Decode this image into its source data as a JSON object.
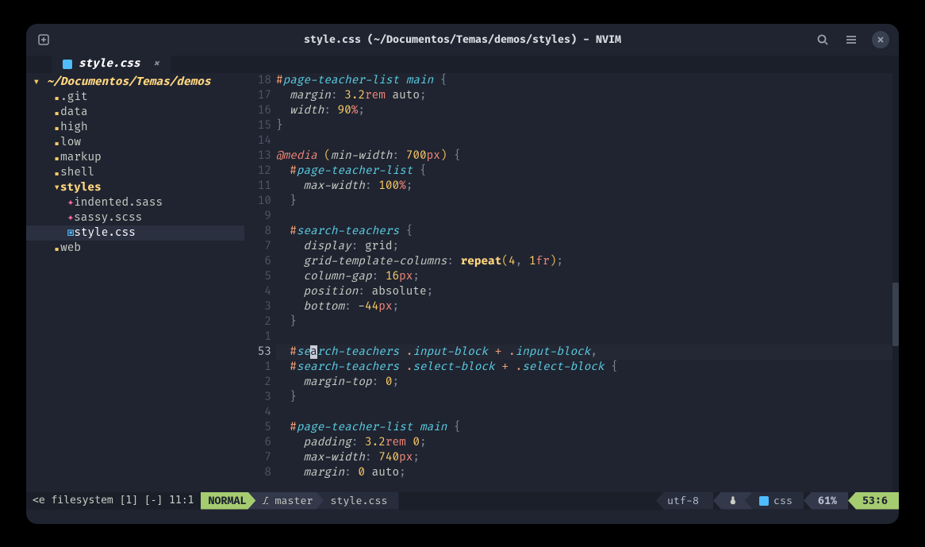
{
  "window": {
    "title": "style.css (~/Documentos/Temas/demos/styles) - NVIM"
  },
  "tab": {
    "label": "style.css",
    "close": "×"
  },
  "tree": {
    "root": "~/Documentos/Temas/demos",
    "items": [
      {
        "indent": 1,
        "type": "folder",
        "name": ".git"
      },
      {
        "indent": 1,
        "type": "folder",
        "name": "data"
      },
      {
        "indent": 1,
        "type": "folder",
        "name": "high"
      },
      {
        "indent": 1,
        "type": "folder",
        "name": "low"
      },
      {
        "indent": 1,
        "type": "folder",
        "name": "markup"
      },
      {
        "indent": 1,
        "type": "folder",
        "name": "shell"
      },
      {
        "indent": 1,
        "type": "folder-open",
        "name": "styles"
      },
      {
        "indent": 2,
        "type": "sass",
        "name": "indented.sass"
      },
      {
        "indent": 2,
        "type": "sass",
        "name": "sassy.scss"
      },
      {
        "indent": 2,
        "type": "css",
        "name": "style.css",
        "selected": true
      },
      {
        "indent": 1,
        "type": "folder",
        "name": "web"
      }
    ]
  },
  "gutter": [
    "18",
    "17",
    "16",
    "15",
    "14",
    "13",
    "12",
    "11",
    "10",
    "9",
    "8",
    "7",
    "6",
    "5",
    "4",
    "3",
    "2",
    "1",
    "53",
    "1",
    "2",
    "3",
    "4",
    "5",
    "6",
    "7",
    "8"
  ],
  "gutter_current_index": 18,
  "code_tokens": [
    [
      [
        "#",
        "op"
      ],
      [
        "page-teacher-list",
        "sel"
      ],
      [
        " ",
        ""
      ],
      [
        "main",
        "sel"
      ],
      [
        " ",
        ""
      ],
      [
        "{",
        "punc"
      ]
    ],
    [
      [
        "  ",
        ""
      ],
      [
        "margin",
        "prop"
      ],
      [
        ":",
        "punc"
      ],
      [
        " ",
        ""
      ],
      [
        "3",
        "num"
      ],
      [
        ".",
        "num"
      ],
      [
        "2",
        "num"
      ],
      [
        "rem",
        "unit"
      ],
      [
        " auto",
        ""
      ],
      [
        ";",
        "punc"
      ]
    ],
    [
      [
        "  ",
        ""
      ],
      [
        "width",
        "prop"
      ],
      [
        ":",
        "punc"
      ],
      [
        " ",
        ""
      ],
      [
        "90",
        "num"
      ],
      [
        "%",
        "unit"
      ],
      [
        ";",
        "punc"
      ]
    ],
    [
      [
        "}",
        "punc"
      ]
    ],
    [],
    [
      [
        "@",
        "at"
      ],
      [
        "media",
        "at"
      ],
      [
        " ",
        ""
      ],
      [
        "(",
        "paren"
      ],
      [
        "min-width",
        "prop"
      ],
      [
        ":",
        "punc"
      ],
      [
        " ",
        ""
      ],
      [
        "700",
        "num"
      ],
      [
        "px",
        "unit"
      ],
      [
        ")",
        "paren"
      ],
      [
        " ",
        ""
      ],
      [
        "{",
        "punc"
      ]
    ],
    [
      [
        "  ",
        ""
      ],
      [
        "#",
        "op"
      ],
      [
        "page-teacher-list",
        "sel"
      ],
      [
        " ",
        ""
      ],
      [
        "{",
        "punc"
      ]
    ],
    [
      [
        "    ",
        ""
      ],
      [
        "max-width",
        "prop"
      ],
      [
        ":",
        "punc"
      ],
      [
        " ",
        ""
      ],
      [
        "100",
        "num"
      ],
      [
        "%",
        "unit"
      ],
      [
        ";",
        "punc"
      ]
    ],
    [
      [
        "  ",
        ""
      ],
      [
        "}",
        "punc"
      ]
    ],
    [],
    [
      [
        "  ",
        ""
      ],
      [
        "#",
        "op"
      ],
      [
        "search-teachers",
        "sel"
      ],
      [
        " ",
        ""
      ],
      [
        "{",
        "punc"
      ]
    ],
    [
      [
        "    ",
        ""
      ],
      [
        "display",
        "prop"
      ],
      [
        ":",
        "punc"
      ],
      [
        " grid",
        ""
      ],
      [
        ";",
        "punc"
      ]
    ],
    [
      [
        "    ",
        ""
      ],
      [
        "grid-template-columns",
        "prop"
      ],
      [
        ":",
        "punc"
      ],
      [
        " ",
        ""
      ],
      [
        "repeat",
        "val"
      ],
      [
        "(",
        "paren"
      ],
      [
        "4",
        "num"
      ],
      [
        ",",
        "punc"
      ],
      [
        " ",
        ""
      ],
      [
        "1",
        "num"
      ],
      [
        "fr",
        "unit"
      ],
      [
        ")",
        "paren"
      ],
      [
        ";",
        "punc"
      ]
    ],
    [
      [
        "    ",
        ""
      ],
      [
        "column-gap",
        "prop"
      ],
      [
        ":",
        "punc"
      ],
      [
        " ",
        ""
      ],
      [
        "16",
        "num"
      ],
      [
        "px",
        "unit"
      ],
      [
        ";",
        "punc"
      ]
    ],
    [
      [
        "    ",
        ""
      ],
      [
        "position",
        "prop"
      ],
      [
        ":",
        "punc"
      ],
      [
        " absolute",
        ""
      ],
      [
        ";",
        "punc"
      ]
    ],
    [
      [
        "    ",
        ""
      ],
      [
        "bottom",
        "prop"
      ],
      [
        ":",
        "punc"
      ],
      [
        " -",
        ""
      ],
      [
        "44",
        "num"
      ],
      [
        "px",
        "unit"
      ],
      [
        ";",
        "punc"
      ]
    ],
    [
      [
        "  ",
        ""
      ],
      [
        "}",
        "punc"
      ]
    ],
    [],
    [
      [
        "  ",
        ""
      ],
      [
        "#",
        "op"
      ],
      [
        "se",
        "sel"
      ],
      [
        "a",
        "cursor"
      ],
      [
        "rch-teachers",
        "sel"
      ],
      [
        " ",
        ""
      ],
      [
        ".",
        "op"
      ],
      [
        "input-block",
        "sel"
      ],
      [
        " ",
        ""
      ],
      [
        "+",
        "op"
      ],
      [
        " ",
        ""
      ],
      [
        ".",
        "op"
      ],
      [
        "input-block",
        "sel"
      ],
      [
        ",",
        "punc"
      ]
    ],
    [
      [
        "  ",
        ""
      ],
      [
        "#",
        "op"
      ],
      [
        "search-teachers",
        "sel"
      ],
      [
        " ",
        ""
      ],
      [
        ".",
        "op"
      ],
      [
        "select-block",
        "sel"
      ],
      [
        " ",
        ""
      ],
      [
        "+",
        "op"
      ],
      [
        " ",
        ""
      ],
      [
        ".",
        "op"
      ],
      [
        "select-block",
        "sel"
      ],
      [
        " ",
        ""
      ],
      [
        "{",
        "punc"
      ]
    ],
    [
      [
        "    ",
        ""
      ],
      [
        "margin-top",
        "prop"
      ],
      [
        ":",
        "punc"
      ],
      [
        " ",
        ""
      ],
      [
        "0",
        "num"
      ],
      [
        ";",
        "punc"
      ]
    ],
    [
      [
        "  ",
        ""
      ],
      [
        "}",
        "punc"
      ]
    ],
    [],
    [
      [
        "  ",
        ""
      ],
      [
        "#",
        "op"
      ],
      [
        "page-teacher-list",
        "sel"
      ],
      [
        " ",
        ""
      ],
      [
        "main",
        "sel"
      ],
      [
        " ",
        ""
      ],
      [
        "{",
        "punc"
      ]
    ],
    [
      [
        "    ",
        ""
      ],
      [
        "padding",
        "prop"
      ],
      [
        ":",
        "punc"
      ],
      [
        " ",
        ""
      ],
      [
        "3",
        "num"
      ],
      [
        ".",
        "num"
      ],
      [
        "2",
        "num"
      ],
      [
        "rem",
        "unit"
      ],
      [
        " ",
        ""
      ],
      [
        "0",
        "num"
      ],
      [
        ";",
        "punc"
      ]
    ],
    [
      [
        "    ",
        ""
      ],
      [
        "max-width",
        "prop"
      ],
      [
        ":",
        "punc"
      ],
      [
        " ",
        ""
      ],
      [
        "740",
        "num"
      ],
      [
        "px",
        "unit"
      ],
      [
        ";",
        "punc"
      ]
    ],
    [
      [
        "    ",
        ""
      ],
      [
        "margin",
        "prop"
      ],
      [
        ":",
        "punc"
      ],
      [
        " ",
        ""
      ],
      [
        "0",
        "num"
      ],
      [
        " auto",
        ""
      ],
      [
        ";",
        "punc"
      ]
    ]
  ],
  "status": {
    "left": "<e filesystem [1] [-]   11:1",
    "mode": "NORMAL",
    "branch_icon": "⎇",
    "branch": "master",
    "filename": "style.css",
    "encoding": "utf-8",
    "os_icon": "🐧",
    "filetype": "css",
    "percent": "61%",
    "position": "53:6"
  }
}
